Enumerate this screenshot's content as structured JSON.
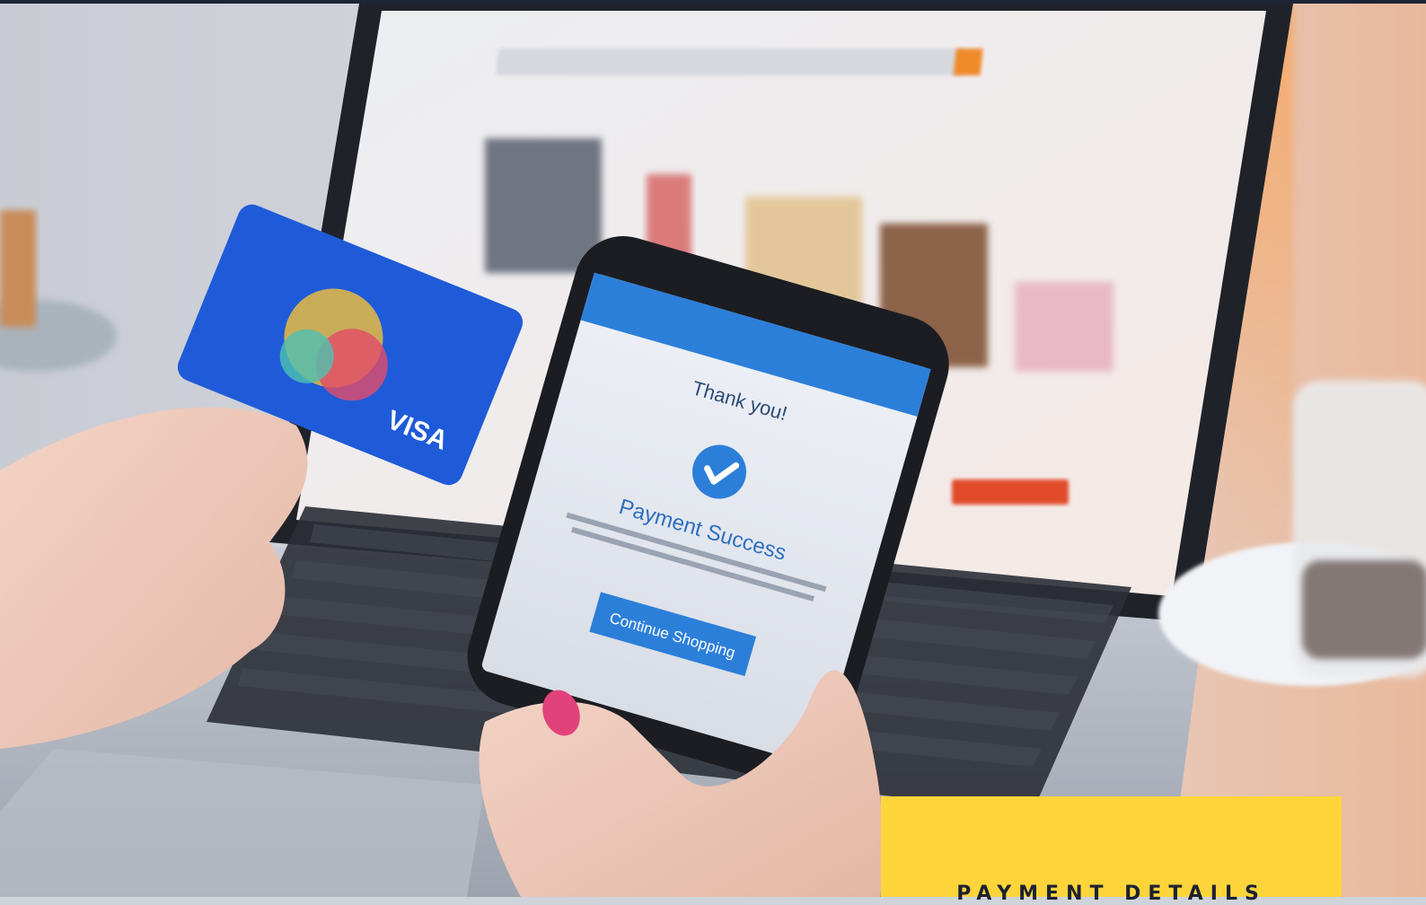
{
  "colors": {
    "top_bar": "#1c2436",
    "accent_yellow": "#fdd53b",
    "card_title": "#1d2230",
    "phone_blue": "#2c7fd9"
  },
  "phone_screen": {
    "heading": "Thank you!",
    "status": "Payment Success",
    "button_label": "Continue Shopping",
    "check_icon": "checkmark-circle-icon"
  },
  "payment_card": {
    "brand": "VISA"
  },
  "info_card": {
    "title": "PAYMENT DETAILS"
  }
}
